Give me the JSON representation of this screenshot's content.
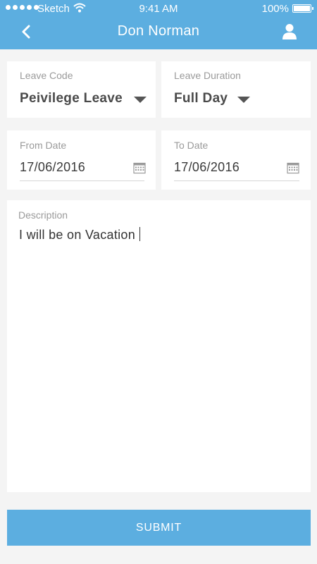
{
  "status_bar": {
    "carrier": "Sketch",
    "time": "9:41 AM",
    "battery": "100%"
  },
  "nav": {
    "title": "Don Norman",
    "back_icon": "chevron-left-icon",
    "profile_icon": "user-icon"
  },
  "form": {
    "leave_code": {
      "label": "Leave Code",
      "value": "Peivilege Leave"
    },
    "leave_duration": {
      "label": "Leave Duration",
      "value": "Full Day"
    },
    "from_date": {
      "label": "From Date",
      "value": "17/06/2016"
    },
    "to_date": {
      "label": "To Date",
      "value": "17/06/2016"
    },
    "description": {
      "label": "Description",
      "value": "I will be on Vacation"
    }
  },
  "submit_label": "SUBMIT",
  "colors": {
    "primary": "#5caee0",
    "background": "#f4f4f4",
    "card": "#ffffff"
  }
}
